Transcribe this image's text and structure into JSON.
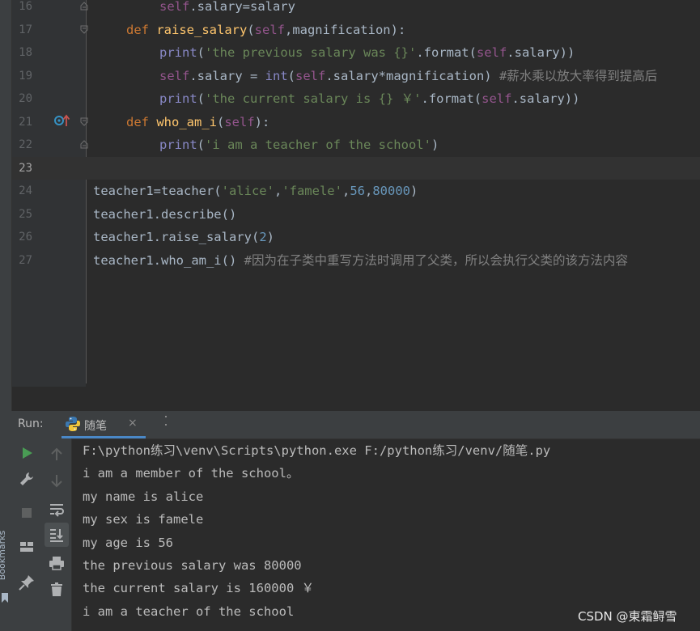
{
  "editor": {
    "lines": [
      {
        "num": "16",
        "tokens": [
          [
            "self",
            "self"
          ],
          [
            ".salary=salary",
            "plain"
          ]
        ],
        "indent": 2
      },
      {
        "num": "17",
        "tokens": [
          [
            "def ",
            "kw"
          ],
          [
            "raise_salary",
            "fn"
          ],
          [
            "(",
            "plain"
          ],
          [
            "self",
            "self"
          ],
          [
            ",magnification):",
            "plain"
          ]
        ],
        "indent": 1
      },
      {
        "num": "18",
        "tokens": [
          [
            "print",
            "builtin"
          ],
          [
            "(",
            "plain"
          ],
          [
            "'the previous salary was {}'",
            "str"
          ],
          [
            ".format(",
            "plain"
          ],
          [
            "self",
            "self"
          ],
          [
            ".salary))",
            "plain"
          ]
        ],
        "indent": 2
      },
      {
        "num": "19",
        "tokens": [
          [
            "self",
            "self"
          ],
          [
            ".salary = ",
            "plain"
          ],
          [
            "int",
            "builtin"
          ],
          [
            "(",
            "plain"
          ],
          [
            "self",
            "self"
          ],
          [
            ".salary*magnification) ",
            "plain"
          ],
          [
            "#薪水乘以放大率得到提高后",
            "cmt"
          ]
        ],
        "indent": 2
      },
      {
        "num": "20",
        "tokens": [
          [
            "print",
            "builtin"
          ],
          [
            "(",
            "plain"
          ],
          [
            "'the current salary is {} ￥'",
            "str"
          ],
          [
            ".format(",
            "plain"
          ],
          [
            "self",
            "self"
          ],
          [
            ".salary))",
            "plain"
          ]
        ],
        "indent": 2
      },
      {
        "num": "21",
        "tokens": [
          [
            "def ",
            "kw"
          ],
          [
            "who_am_i",
            "fn"
          ],
          [
            "(",
            "plain"
          ],
          [
            "self",
            "self"
          ],
          [
            "):",
            "plain"
          ]
        ],
        "indent": 1
      },
      {
        "num": "22",
        "tokens": [
          [
            "print",
            "builtin"
          ],
          [
            "(",
            "plain"
          ],
          [
            "'i am a teacher of the school'",
            "str"
          ],
          [
            ")",
            "plain"
          ]
        ],
        "indent": 2
      },
      {
        "num": "23",
        "tokens": [],
        "indent": 0
      },
      {
        "num": "24",
        "tokens": [
          [
            "teacher1=teacher(",
            "plain"
          ],
          [
            "'alice'",
            "str"
          ],
          [
            ",",
            "plain"
          ],
          [
            "'famele'",
            "str"
          ],
          [
            ",",
            "plain"
          ],
          [
            "56",
            "num"
          ],
          [
            ",",
            "plain"
          ],
          [
            "80000",
            "num"
          ],
          [
            ")",
            "plain"
          ]
        ],
        "indent": 0
      },
      {
        "num": "25",
        "tokens": [
          [
            "teacher1.describe()",
            "plain"
          ]
        ],
        "indent": 0
      },
      {
        "num": "26",
        "tokens": [
          [
            "teacher1.raise_salary(",
            "plain"
          ],
          [
            "2",
            "num"
          ],
          [
            ")",
            "plain"
          ]
        ],
        "indent": 0
      },
      {
        "num": "27",
        "tokens": [
          [
            "teacher1.who_am_i() ",
            "plain"
          ],
          [
            "#因为在子类中重写方法时调用了父类，所以会执行父类的该方法内容",
            "cmt"
          ]
        ],
        "indent": 0
      }
    ]
  },
  "sidebar": {
    "bookmarks_label": "Bookmarks"
  },
  "run_panel": {
    "label": "Run:",
    "tab_label": "随笔",
    "tab_close": "×",
    "output": [
      "F:\\python练习\\venv\\Scripts\\python.exe F:/python练习/venv/随笔.py",
      "i am a member of the school。",
      "my name is alice",
      "my sex is famele",
      "my age is 56",
      "the previous salary was 80000",
      "the current salary is 160000 ￥",
      "i am a teacher of the school"
    ]
  },
  "watermark": "CSDN @東霜鲟雪",
  "colors": {
    "accent_run": "#499c54",
    "tab_underline": "#4a88c7",
    "keyword": "#cc7832",
    "function": "#ffc66d",
    "self": "#94558d",
    "string": "#6a8759",
    "number": "#6897bb",
    "comment": "#808080"
  }
}
